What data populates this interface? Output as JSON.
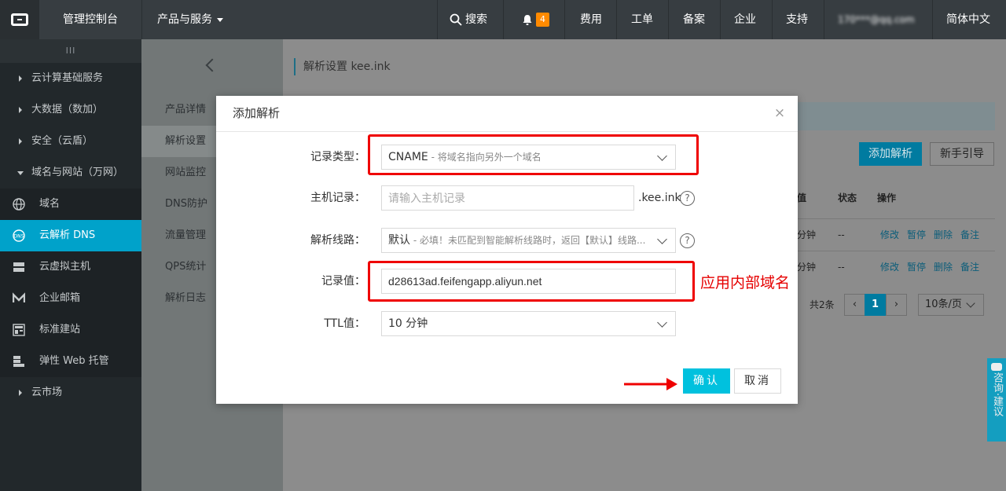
{
  "topbar": {
    "console": "管理控制台",
    "products": "产品与服务",
    "search": "搜索",
    "notify_count": "4",
    "billing": "费用",
    "ticket": "工单",
    "beian": "备案",
    "enterprise": "企业",
    "support": "支持",
    "account": "170***@qq.com",
    "language": "简体中文"
  },
  "sidebar": {
    "grip": "III",
    "groups": [
      {
        "label": "云计算基础服务"
      },
      {
        "label": "大数据（数加）"
      },
      {
        "label": "安全（云盾）"
      },
      {
        "label": "域名与网站（万网）"
      }
    ],
    "subitems": [
      {
        "label": "域名",
        "icon": "globe-icon"
      },
      {
        "label": "云解析 DNS",
        "icon": "dns-icon"
      },
      {
        "label": "云虚拟主机",
        "icon": "server-icon"
      },
      {
        "label": "企业邮箱",
        "icon": "mail-icon"
      },
      {
        "label": "标准建站",
        "icon": "site-icon"
      },
      {
        "label": "弹性 Web 托管",
        "icon": "hosting-icon"
      }
    ],
    "market": "云市场"
  },
  "subnav": {
    "items": [
      {
        "label": "产品详情"
      },
      {
        "label": "解析设置"
      },
      {
        "label": "网站监控"
      },
      {
        "label": "DNS防护"
      },
      {
        "label": "流量管理"
      },
      {
        "label": "QPS统计"
      },
      {
        "label": "解析日志"
      }
    ]
  },
  "main": {
    "breadcrumb": "解析设置 kee.ink",
    "add_button": "添加解析",
    "guide_button": "新手引导",
    "columns": {
      "value": "值",
      "status": "状态",
      "actions": "操作"
    },
    "rows": [
      {
        "ttl": "分钟",
        "status": "--",
        "actions": [
          "修改",
          "暂停",
          "删除",
          "备注"
        ]
      },
      {
        "ttl": "分钟",
        "status": "--",
        "actions": [
          "修改",
          "暂停",
          "删除",
          "备注"
        ]
      }
    ],
    "total": "共2条",
    "page": "1",
    "page_size": "10条/页"
  },
  "feedback": {
    "label": "咨询·建议"
  },
  "modal": {
    "title": "添加解析",
    "record_type": {
      "label": "记录类型：",
      "value": "CNAME",
      "hint": " - 将域名指向另外一个域名"
    },
    "host": {
      "label": "主机记录：",
      "placeholder": "请输入主机记录",
      "suffix": ".kee.ink"
    },
    "line": {
      "label": "解析线路：",
      "value": "默认",
      "hint": " - 必填！未匹配到智能解析线路时，返回【默认】线路..."
    },
    "record_value": {
      "label": "记录值：",
      "value": "d28613ad.feifengapp.aliyun.net"
    },
    "ttl": {
      "label": "TTL值：",
      "value": "10 分钟"
    },
    "confirm": "确认",
    "cancel": "取消"
  },
  "annotation": {
    "note": "应用内部域名",
    "color": "#ef0000"
  },
  "colors": {
    "accent": "#00c1de",
    "active_sidebar": "#00a2ca",
    "topbar": "#373d41",
    "sidebar": "#22282b"
  }
}
